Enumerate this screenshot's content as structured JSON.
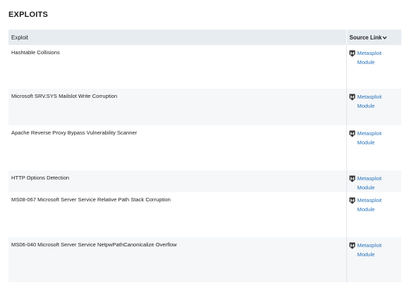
{
  "section": {
    "title": "EXPLOITS"
  },
  "table": {
    "col_exploit": "Exploit",
    "col_source": "Source Link",
    "rows": [
      {
        "exploit": "Hashtable Collisions",
        "source_line1": "Metasploit",
        "source_line2": "Module"
      },
      {
        "exploit": "Microsoft SRV.SYS Mailslot Write Corruption",
        "source_line1": "Metasploit",
        "source_line2": "Module"
      },
      {
        "exploit": "Apache Reverse Proxy Bypass Vulnerability Scanner",
        "source_line1": "Metasploit",
        "source_line2": "Module"
      },
      {
        "exploit": "HTTP Options Detection",
        "source_line1": "Metasploit",
        "source_line2": "Module"
      },
      {
        "exploit": "MS08-067 Microsoft Server Service Relative Path Stack Corruption",
        "source_line1": "Metasploit",
        "source_line2": "Module"
      },
      {
        "exploit": "MS06-040 Microsoft Server Service NetpwPathCanonicalize Overflow",
        "source_line1": "Metasploit",
        "source_line2": "Module"
      }
    ]
  },
  "icons": {
    "source_sort": "chevron-down-icon",
    "source_type": "metasploit-icon"
  },
  "colors": {
    "header_bg": "#e7ecf1",
    "stripe_bg": "#f5f7f9",
    "link": "#2a73b8"
  }
}
